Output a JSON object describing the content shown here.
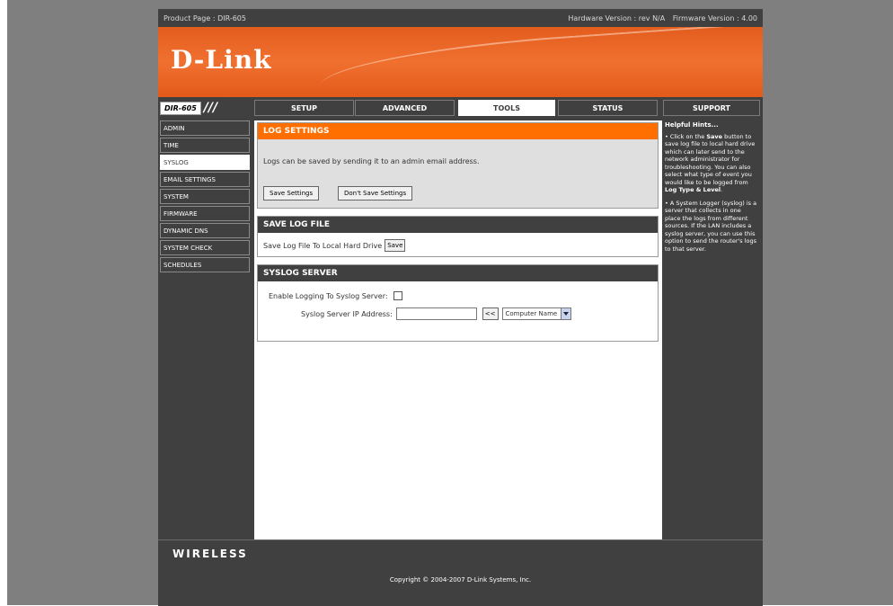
{
  "info_bar": {
    "product": "Product Page : DIR-605",
    "hardware": "Hardware Version : rev N/A",
    "firmware": "Firmware Version : 4.00"
  },
  "brand": {
    "logo": "D-Link"
  },
  "model": {
    "name": "DIR-605",
    "slashes": "///"
  },
  "tabs": [
    {
      "label": "SETUP"
    },
    {
      "label": "ADVANCED"
    },
    {
      "label": "TOOLS"
    },
    {
      "label": "STATUS"
    },
    {
      "label": "SUPPORT"
    }
  ],
  "active_tab": "TOOLS",
  "sidebar": {
    "items": [
      {
        "label": "ADMIN"
      },
      {
        "label": "TIME"
      },
      {
        "label": "SYSLOG"
      },
      {
        "label": "EMAIL SETTINGS"
      },
      {
        "label": "SYSTEM"
      },
      {
        "label": "FIRMWARE"
      },
      {
        "label": "DYNAMIC DNS"
      },
      {
        "label": "SYSTEM CHECK"
      },
      {
        "label": "SCHEDULES"
      }
    ],
    "active": "SYSLOG"
  },
  "log_settings": {
    "title": "LOG SETTINGS",
    "description": "Logs can be saved by sending it to an admin email address.",
    "save_button": "Save Settings",
    "dont_save_button": "Don't Save Settings"
  },
  "save_log_file": {
    "title": "SAVE LOG FILE",
    "label": "Save Log File To Local Hard Drive",
    "save_button": "Save"
  },
  "syslog_server": {
    "title": "SYSLOG SERVER",
    "enable_label": "Enable Logging To Syslog Server:",
    "ip_label": "Syslog Server IP Address:",
    "ip_value": "",
    "copy_button": "<<",
    "computer_select": "Computer Name"
  },
  "help": {
    "title": "Helpful Hints...",
    "hint1_pre": "• Click on the ",
    "hint1_save": "Save",
    "hint1_mid": " button to save log file to local hard drive which can later send to the network administrator for troubleshooting. You can also select what type of event you would like to be logged from ",
    "hint1_bold": "Log Type & Level",
    "hint1_end": ".",
    "hint2": "• A System Logger (syslog) is a server that collects in one place the logs from different sources. If the LAN includes a syslog server, you can use this option to send the router's logs to that server."
  },
  "footer": {
    "wireless": "WIRELESS",
    "copyright": "Copyright © 2004-2007 D-Link Systems, Inc."
  },
  "colors": {
    "accent_orange": "#ff6f00",
    "dark": "#404040",
    "page_bg": "#7f7f7f"
  }
}
